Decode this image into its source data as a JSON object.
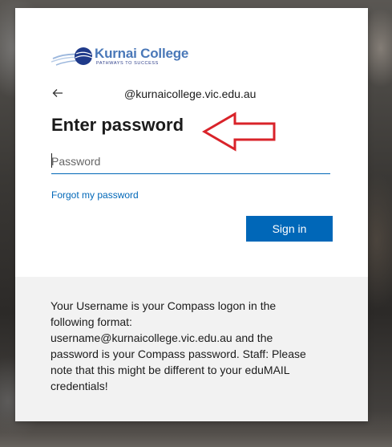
{
  "brand": {
    "name": "Kurnai College",
    "tagline": "PATHWAYS TO SUCCESS",
    "accent_color": "#4a78b8"
  },
  "header": {
    "back_icon": "arrow-left-icon",
    "identity": "@kurnaicollege.vic.edu.au"
  },
  "page": {
    "title": "Enter password"
  },
  "password_field": {
    "placeholder": "Password",
    "value": ""
  },
  "links": {
    "forgot_password": "Forgot my password"
  },
  "actions": {
    "sign_in_label": "Sign in",
    "primary_color": "#0067b8"
  },
  "annotation": {
    "arrow_color": "#d9232a",
    "arrow_icon": "red-outline-arrow-left"
  },
  "footer": {
    "message": "Your Username is your Compass logon in the following format: username@kurnaicollege.vic.edu.au and the password is your Compass password. Staff: Please note that this might be different to your eduMAIL credentials!"
  }
}
